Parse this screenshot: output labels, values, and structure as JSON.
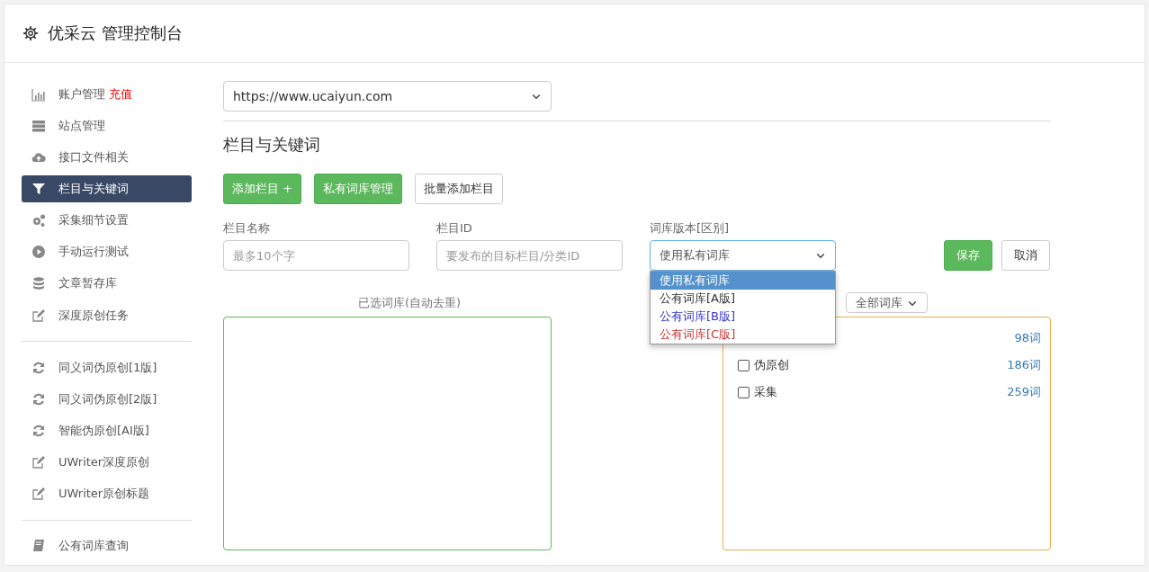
{
  "header": {
    "title": "优采云 管理控制台"
  },
  "sidebar": {
    "groups": [
      {
        "items": [
          {
            "label": "账户管理",
            "badge": "充值",
            "selected": false
          },
          {
            "label": "站点管理",
            "selected": false
          },
          {
            "label": "接口文件相关",
            "selected": false
          },
          {
            "label": "栏目与关键词",
            "selected": true
          },
          {
            "label": "采集细节设置",
            "selected": false
          },
          {
            "label": "手动运行测试",
            "selected": false
          },
          {
            "label": "文章暂存库",
            "selected": false
          },
          {
            "label": "深度原创任务",
            "selected": false
          }
        ]
      },
      {
        "items": [
          {
            "label": "同义词伪原创[1版]",
            "selected": false
          },
          {
            "label": "同义词伪原创[2版]",
            "selected": false
          },
          {
            "label": "智能伪原创[AI版]",
            "selected": false
          },
          {
            "label": "UWriter深度原创",
            "selected": false
          },
          {
            "label": "UWriter原创标题",
            "selected": false
          }
        ]
      },
      {
        "items": [
          {
            "label": "公有词库查询",
            "selected": false
          }
        ]
      }
    ]
  },
  "main": {
    "site_select": {
      "value": "https://www.ucaiyun.com"
    },
    "section_title": "栏目与关键词",
    "buttons": [
      {
        "label": "添加栏目 +",
        "kind": "primary"
      },
      {
        "label": "私有词库管理",
        "kind": "primary"
      },
      {
        "label": "批量添加栏目",
        "kind": "default"
      }
    ],
    "form": {
      "fields": [
        {
          "label": "栏目名称",
          "placeholder": "最多10个字"
        },
        {
          "label": "栏目ID",
          "placeholder": "要发布的目标栏目/分类ID"
        }
      ],
      "version": {
        "label": "词库版本[区别]",
        "value": "使用私有词库",
        "expanded": true,
        "options": [
          {
            "label": "使用私有词库",
            "selected": true
          },
          {
            "label": "公有词库[A版]",
            "selected": false,
            "color": "#333333"
          },
          {
            "label": "公有词库[B版]",
            "selected": false,
            "color": "#3333cc"
          },
          {
            "label": "公有词库[C版]",
            "selected": false,
            "color": "#cc3333"
          }
        ]
      },
      "save": "保存",
      "cancel": "取消"
    },
    "selected_label": "已选词库(自动去重)",
    "filter_select": {
      "value": "全部词库"
    },
    "libraries": [
      {
        "count": "98词"
      },
      {
        "label": "伪原创",
        "count": "186词",
        "checked": false
      },
      {
        "label": "采集",
        "count": "259词",
        "checked": false
      }
    ]
  }
}
